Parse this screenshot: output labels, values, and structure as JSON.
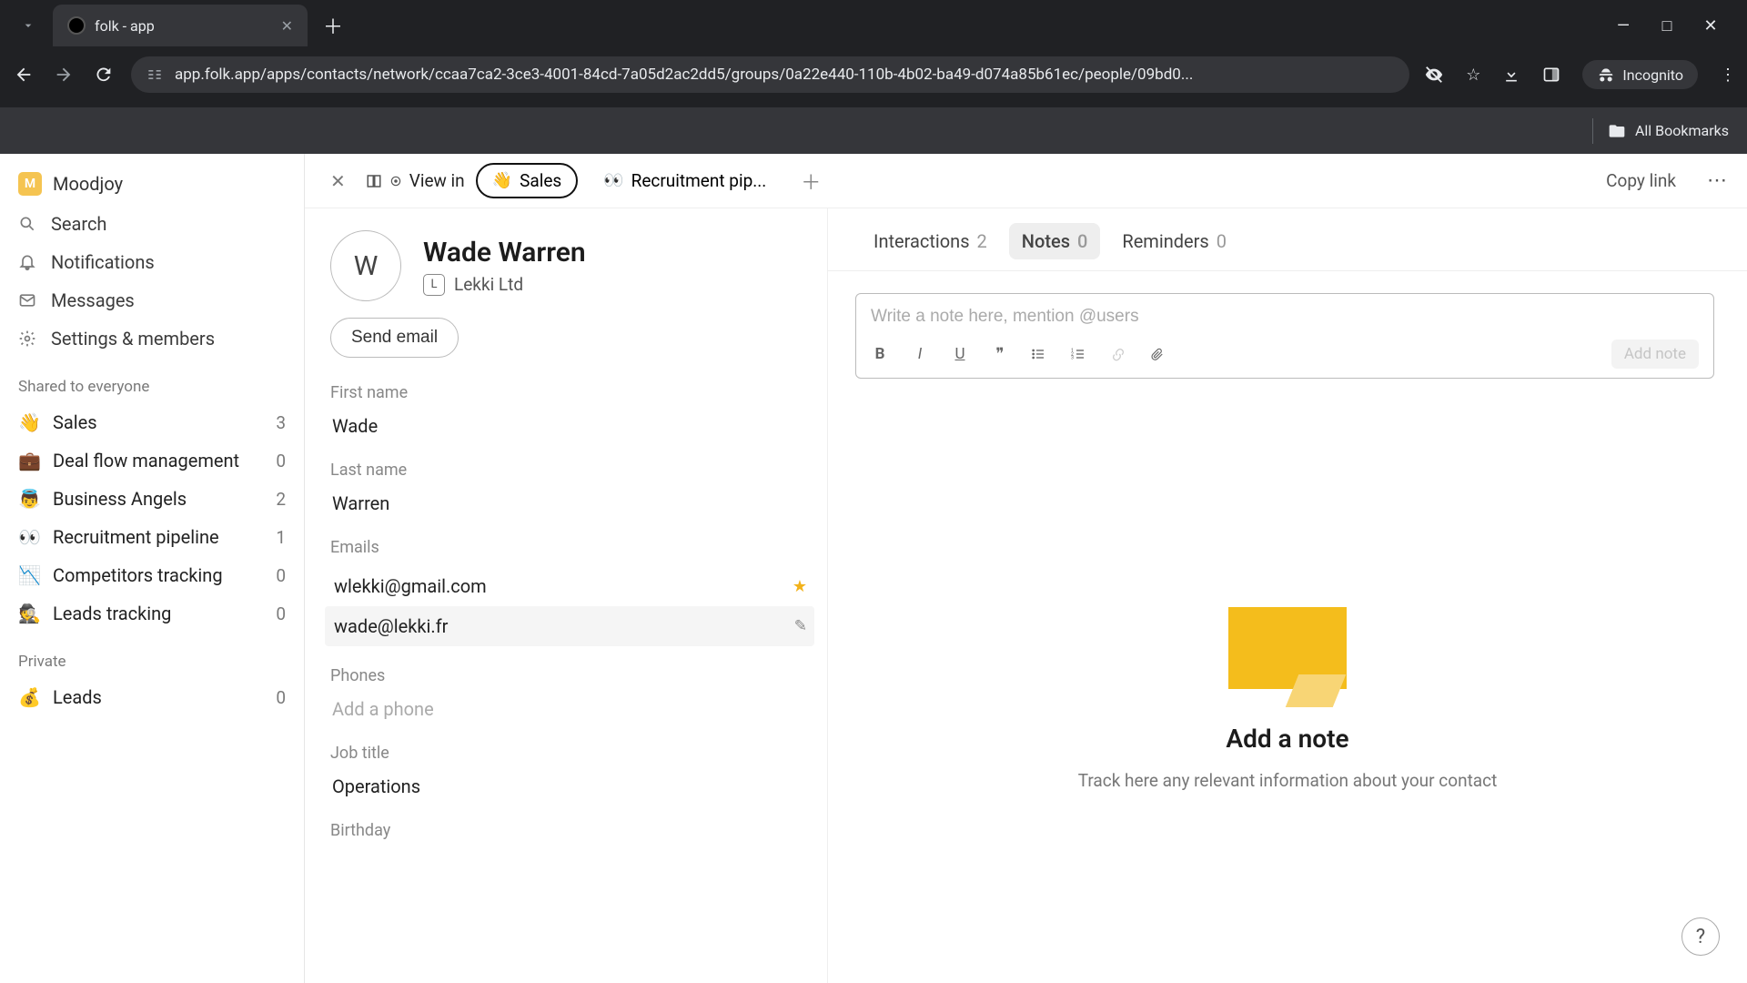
{
  "browser": {
    "tab_title": "folk - app",
    "url": "app.folk.app/apps/contacts/network/ccaa7ca2-3ce3-4001-84cd-7a05d2ac2dd5/groups/0a22e440-110b-4b02-ba49-d074a85b61ec/people/09bd0...",
    "incognito_label": "Incognito",
    "all_bookmarks": "All Bookmarks"
  },
  "workspace": {
    "name": "Moodjoy",
    "badge": "M"
  },
  "side_links": {
    "search": "Search",
    "notifications": "Notifications",
    "messages": "Messages",
    "settings": "Settings & members"
  },
  "sections": {
    "shared": "Shared to everyone",
    "private": "Private"
  },
  "groups_shared": [
    {
      "emoji": "👋",
      "label": "Sales",
      "count": "3"
    },
    {
      "emoji": "💼",
      "label": "Deal flow management",
      "count": "0"
    },
    {
      "emoji": "👼",
      "label": "Business Angels",
      "count": "2"
    },
    {
      "emoji": "👀",
      "label": "Recruitment pipeline",
      "count": "1"
    },
    {
      "emoji": "📉",
      "label": "Competitors tracking",
      "count": "0"
    },
    {
      "emoji": "🕵️",
      "label": "Leads tracking",
      "count": "0"
    }
  ],
  "groups_private": [
    {
      "emoji": "💰",
      "label": "Leads",
      "count": "0"
    }
  ],
  "viewin": {
    "label": "View in",
    "pills": [
      {
        "emoji": "👋",
        "label": "Sales",
        "active": true
      },
      {
        "emoji": "👀",
        "label": "Recruitment pip...",
        "active": false
      }
    ],
    "copy": "Copy link"
  },
  "contact": {
    "initial": "W",
    "name": "Wade Warren",
    "company_initial": "L",
    "company": "Lekki Ltd",
    "send_email": "Send email",
    "fields": {
      "first_name_label": "First name",
      "first_name": "Wade",
      "last_name_label": "Last name",
      "last_name": "Warren",
      "emails_label": "Emails",
      "emails": [
        {
          "value": "wlekki@gmail.com",
          "starred": true
        },
        {
          "value": "wade@lekki.fr",
          "starred": false
        }
      ],
      "phones_label": "Phones",
      "phones_placeholder": "Add a phone",
      "job_label": "Job title",
      "job": "Operations",
      "birthday_label": "Birthday"
    }
  },
  "right": {
    "tabs": [
      {
        "label": "Interactions",
        "count": "2",
        "active": false
      },
      {
        "label": "Notes",
        "count": "0",
        "active": true
      },
      {
        "label": "Reminders",
        "count": "0",
        "active": false
      }
    ],
    "note_placeholder": "Write a note here, mention @users",
    "add_note": "Add note",
    "empty_title": "Add a note",
    "empty_sub": "Track here any relevant information about your contact",
    "help": "?"
  }
}
